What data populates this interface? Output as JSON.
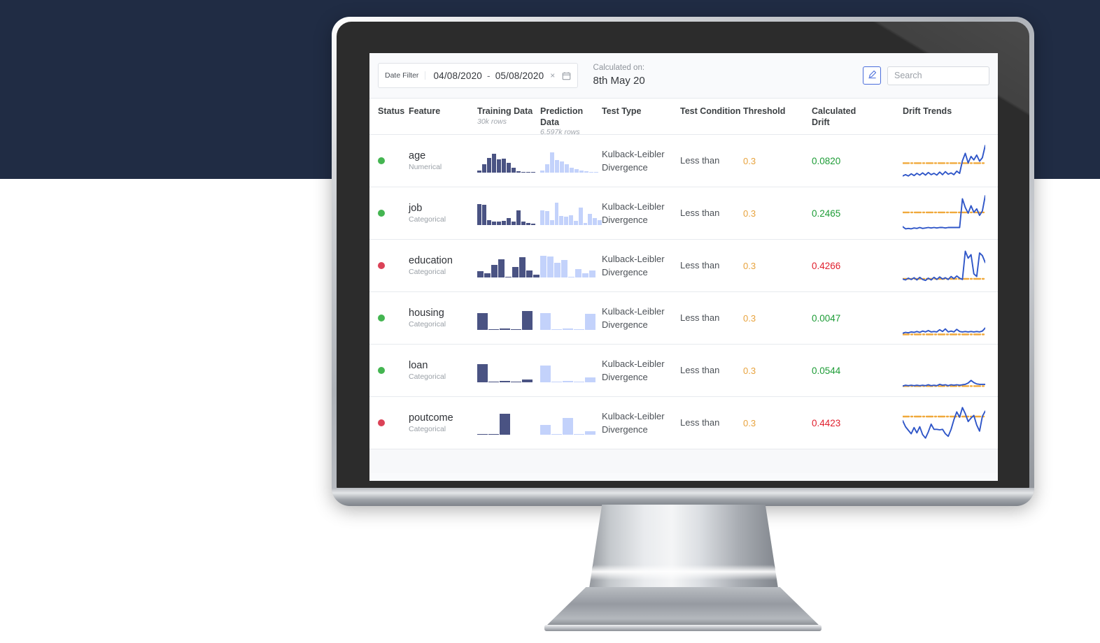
{
  "theme": {
    "background_navy": "#202c44",
    "accent_blue": "#4a6ddb",
    "threshold_orange": "#e8a33d",
    "pass_green": "#1d9c36",
    "fail_red": "#e0202e",
    "dot_pass": "#44b551",
    "dot_fail": "#db4257",
    "hist_train": "#4a5383",
    "hist_pred": "#c3d2fb",
    "spark_line": "#2f56c8",
    "spark_threshold": "#f0a93c"
  },
  "toolbar": {
    "date_filter_label": "Date Filter",
    "date_from": "04/08/2020",
    "date_separator": "-",
    "date_to": "05/08/2020",
    "clear_label": "×",
    "calendar_icon": "calendar-icon",
    "calculated_on_label": "Calculated on:",
    "calculated_on_value": "8th May 20",
    "edit_icon": "pencil-icon",
    "search_placeholder": "Search",
    "search_value": ""
  },
  "table": {
    "headers": {
      "status": "Status",
      "feature": "Feature",
      "training_data": "Training Data",
      "training_data_sub": "30k rows",
      "prediction_data": "Prediction Data",
      "prediction_data_sub": "6.597k rows",
      "test_type": "Test Type",
      "test_condition": "Test Condition",
      "threshold": "Threshold",
      "calculated_drift": "Calculated Drift",
      "drift_trends": "Drift Trends"
    },
    "rows": [
      {
        "status": "pass",
        "feature": "age",
        "feature_type": "Numerical",
        "test_type": "Kulback-Leibler Divergence",
        "test_condition": "Less than",
        "threshold": "0.3",
        "calculated_drift": "0.0820",
        "drift_state": "pass"
      },
      {
        "status": "pass",
        "feature": "job",
        "feature_type": "Categorical",
        "test_type": "Kulback-Leibler Divergence",
        "test_condition": "Less than",
        "threshold": "0.3",
        "calculated_drift": "0.2465",
        "drift_state": "pass"
      },
      {
        "status": "fail",
        "feature": "education",
        "feature_type": "Categorical",
        "test_type": "Kulback-Leibler Divergence",
        "test_condition": "Less than",
        "threshold": "0.3",
        "calculated_drift": "0.4266",
        "drift_state": "fail"
      },
      {
        "status": "pass",
        "feature": "housing",
        "feature_type": "Categorical",
        "test_type": "Kulback-Leibler Divergence",
        "test_condition": "Less than",
        "threshold": "0.3",
        "calculated_drift": "0.0047",
        "drift_state": "pass"
      },
      {
        "status": "pass",
        "feature": "loan",
        "feature_type": "Categorical",
        "test_type": "Kulback-Leibler Divergence",
        "test_condition": "Less than",
        "threshold": "0.3",
        "calculated_drift": "0.0544",
        "drift_state": "pass"
      },
      {
        "status": "fail",
        "feature": "poutcome",
        "feature_type": "Categorical",
        "test_type": "Kulback-Leibler Divergence",
        "test_condition": "Less than",
        "threshold": "0.3",
        "calculated_drift": "0.4423",
        "drift_state": "fail"
      }
    ]
  },
  "chart_data": [
    {
      "type": "bar",
      "title": "age - Training Data distribution",
      "feature": "age",
      "dataset": "training",
      "bar_width": "narrow",
      "values": [
        8,
        34,
        62,
        80,
        56,
        58,
        40,
        20,
        6,
        3,
        2,
        1
      ],
      "ylim": [
        0,
        100
      ]
    },
    {
      "type": "bar",
      "title": "age - Prediction Data distribution",
      "feature": "age",
      "dataset": "prediction",
      "bar_width": "narrow",
      "values": [
        10,
        34,
        84,
        52,
        48,
        34,
        22,
        16,
        9,
        5,
        4,
        3
      ],
      "ylim": [
        0,
        100
      ]
    },
    {
      "type": "bar",
      "title": "job - Training Data distribution",
      "feature": "job",
      "dataset": "training",
      "bar_width": "narrow",
      "values": [
        88,
        84,
        20,
        14,
        16,
        17,
        30,
        14,
        62,
        16,
        8,
        7
      ],
      "ylim": [
        0,
        100
      ]
    },
    {
      "type": "bar",
      "title": "job - Prediction Data distribution",
      "feature": "job",
      "dataset": "prediction",
      "bar_width": "narrow",
      "values": [
        62,
        60,
        22,
        94,
        38,
        36,
        40,
        18,
        74,
        10,
        48,
        30,
        20
      ],
      "ylim": [
        0,
        100
      ]
    },
    {
      "type": "bar",
      "title": "education - Training Data distribution",
      "feature": "education",
      "dataset": "training",
      "bar_width": "wide",
      "values": [
        26,
        18,
        52,
        76,
        0,
        44,
        86,
        30,
        12
      ],
      "ylim": [
        0,
        100
      ]
    },
    {
      "type": "bar",
      "title": "education - Prediction Data distribution",
      "feature": "education",
      "dataset": "prediction",
      "bar_width": "wide",
      "values": [
        90,
        88,
        62,
        74,
        0,
        34,
        18,
        30
      ],
      "ylim": [
        0,
        100
      ]
    },
    {
      "type": "bar",
      "title": "housing - Training Data distribution",
      "feature": "housing",
      "dataset": "training",
      "bar_width": "xwide",
      "values": [
        72,
        0,
        6,
        0,
        80
      ],
      "ylim": [
        0,
        100
      ]
    },
    {
      "type": "bar",
      "title": "housing - Prediction Data distribution",
      "feature": "housing",
      "dataset": "prediction",
      "bar_width": "xwide",
      "values": [
        72,
        0,
        6,
        0,
        68
      ],
      "ylim": [
        0,
        100
      ]
    },
    {
      "type": "bar",
      "title": "loan - Training Data distribution",
      "feature": "loan",
      "dataset": "training",
      "bar_width": "xwide",
      "values": [
        76,
        0,
        5,
        0,
        12
      ],
      "ylim": [
        0,
        100
      ]
    },
    {
      "type": "bar",
      "title": "loan - Prediction Data distribution",
      "feature": "loan",
      "dataset": "prediction",
      "bar_width": "xwide",
      "values": [
        70,
        0,
        5,
        0,
        20
      ],
      "ylim": [
        0,
        100
      ]
    },
    {
      "type": "bar",
      "title": "poutcome - Training Data distribution",
      "feature": "poutcome",
      "dataset": "training",
      "bar_width": "xwide",
      "values": [
        4,
        0,
        88
      ],
      "ylim": [
        0,
        100
      ]
    },
    {
      "type": "bar",
      "title": "poutcome - Prediction Data distribution",
      "feature": "poutcome",
      "dataset": "prediction",
      "bar_width": "xwide",
      "values": [
        42,
        0,
        70,
        0,
        16
      ],
      "ylim": [
        0,
        100
      ]
    },
    {
      "type": "line",
      "title": "age - Drift Trend",
      "feature": "age",
      "ylabel": "drift",
      "threshold": 0.3,
      "threshold_y_frac": 0.44,
      "values": [
        0.1,
        0.13,
        0.1,
        0.15,
        0.11,
        0.16,
        0.12,
        0.17,
        0.12,
        0.18,
        0.13,
        0.16,
        0.12,
        0.19,
        0.13,
        0.2,
        0.14,
        0.17,
        0.13,
        0.21,
        0.16,
        0.45,
        0.62,
        0.4,
        0.55,
        0.47,
        0.58,
        0.44,
        0.52,
        0.8
      ],
      "ylim": [
        0,
        0.9
      ]
    },
    {
      "type": "line",
      "title": "job - Drift Trend",
      "feature": "job",
      "ylabel": "drift",
      "threshold": 0.3,
      "threshold_y_frac": 0.52,
      "values": [
        0.14,
        0.09,
        0.1,
        0.09,
        0.11,
        0.1,
        0.12,
        0.1,
        0.11,
        0.12,
        0.11,
        0.12,
        0.11,
        0.12,
        0.12,
        0.11,
        0.12,
        0.12,
        0.12,
        0.12,
        0.12,
        0.78,
        0.58,
        0.45,
        0.62,
        0.47,
        0.55,
        0.4,
        0.5,
        0.85
      ],
      "ylim": [
        0,
        0.9
      ]
    },
    {
      "type": "line",
      "title": "education - Drift Trend",
      "feature": "education",
      "ylabel": "drift",
      "threshold": 0.3,
      "threshold_y_frac": 0.16,
      "values": [
        0.14,
        0.12,
        0.16,
        0.13,
        0.17,
        0.12,
        0.18,
        0.13,
        0.11,
        0.16,
        0.12,
        0.18,
        0.13,
        0.19,
        0.14,
        0.17,
        0.13,
        0.2,
        0.15,
        0.21,
        0.16,
        0.13,
        0.78,
        0.62,
        0.7,
        0.26,
        0.2,
        0.74,
        0.68,
        0.52
      ],
      "ylim": [
        0,
        0.9
      ]
    },
    {
      "type": "line",
      "title": "housing - Drift Trend",
      "feature": "housing",
      "ylabel": "drift",
      "threshold": 0.3,
      "threshold_y_frac": 0.08,
      "values": [
        0.1,
        0.12,
        0.11,
        0.13,
        0.12,
        0.14,
        0.12,
        0.15,
        0.13,
        0.16,
        0.13,
        0.14,
        0.13,
        0.18,
        0.14,
        0.2,
        0.13,
        0.15,
        0.13,
        0.19,
        0.14,
        0.13,
        0.14,
        0.13,
        0.14,
        0.13,
        0.14,
        0.13,
        0.15,
        0.22
      ],
      "ylim": [
        0,
        0.9
      ]
    },
    {
      "type": "line",
      "title": "loan - Drift Trend",
      "feature": "loan",
      "ylabel": "drift",
      "threshold": 0.3,
      "threshold_y_frac": 0.1,
      "values": [
        0.09,
        0.11,
        0.1,
        0.11,
        0.1,
        0.11,
        0.1,
        0.11,
        0.1,
        0.12,
        0.1,
        0.11,
        0.1,
        0.13,
        0.11,
        0.12,
        0.1,
        0.12,
        0.11,
        0.12,
        0.11,
        0.12,
        0.13,
        0.16,
        0.22,
        0.17,
        0.14,
        0.13,
        0.13,
        0.13
      ],
      "ylim": [
        0,
        0.9
      ]
    },
    {
      "type": "line",
      "title": "poutcome - Drift Trend",
      "feature": "poutcome",
      "ylabel": "drift",
      "threshold": 0.3,
      "threshold_y_frac": 0.66,
      "values": [
        0.5,
        0.36,
        0.28,
        0.2,
        0.34,
        0.22,
        0.36,
        0.18,
        0.1,
        0.24,
        0.42,
        0.3,
        0.3,
        0.29,
        0.3,
        0.2,
        0.14,
        0.3,
        0.52,
        0.7,
        0.58,
        0.8,
        0.66,
        0.48,
        0.56,
        0.62,
        0.4,
        0.26,
        0.6,
        0.72
      ],
      "ylim": [
        0,
        0.9
      ]
    }
  ],
  "decorations": {
    "magnifier_icon": "magnifying-glass-icon"
  }
}
